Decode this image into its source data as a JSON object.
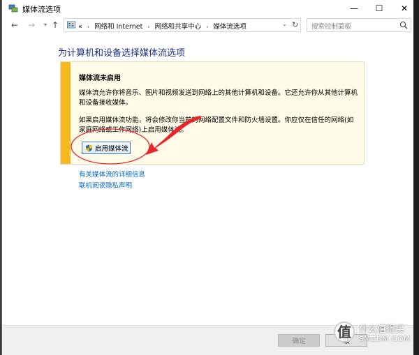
{
  "window": {
    "title": "媒体流选项",
    "min_glyph": "—",
    "max_glyph": "☐",
    "close_glyph": "✕"
  },
  "nav": {
    "back_glyph": "←",
    "forward_glyph": "→",
    "dropdown_glyph": "▾",
    "up_glyph": "↑",
    "crumb_prefix": "«",
    "breadcrumbs": [
      "网络和 Internet",
      "网络和共享中心",
      "媒体流选项"
    ],
    "crumb_sep": "›",
    "history_chevron": "⌄",
    "refresh_glyph": "↻",
    "search_placeholder": "搜索控制面板"
  },
  "main": {
    "title": "为计算机和设备选择媒体流选项",
    "info": {
      "heading": "媒体流未启用",
      "para1": "媒体流允许你将音乐、图片和视频发送到网络上的其他计算机和设备。它还允许你从其他计算机和设备接收媒体。",
      "para2": "如果启用媒体流功能，将会修改你当前的网络配置文件和防火墙设置。你应仅在信任的网络(如家庭网络或工作网络)上启用媒体流。",
      "enable_button": "启用媒体流"
    },
    "links": {
      "details": "有关媒体流的详细信息",
      "privacy": "联机阅读隐私声明"
    }
  },
  "footer": {
    "ok": "确定",
    "cancel": "取"
  },
  "watermark": {
    "badge": "值",
    "line1": "什么值得买",
    "line2": "SMZDM.COM"
  },
  "colors": {
    "accent_bar": "#f5b922",
    "title_blue": "#1e3287",
    "link_blue": "#0066cc",
    "annotation_red": "#e8262a"
  },
  "icons": {
    "title": "media-stream-icon",
    "address": "control-panel-icon",
    "search": "search-icon",
    "button": "uac-shield-icon"
  }
}
